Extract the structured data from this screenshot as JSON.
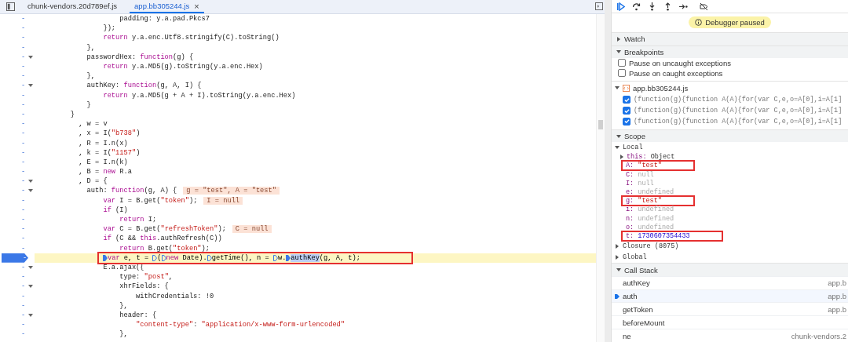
{
  "tabs": [
    {
      "label": "chunk-vendors.20d789ef.js",
      "selected": false
    },
    {
      "label": "app.bb305244.js",
      "selected": true,
      "close": "×"
    }
  ],
  "code_lines": [
    {
      "kind": "code",
      "number": "-",
      "fold": false,
      "text": "                    padding: y.a.pad.Pkcs7"
    },
    {
      "kind": "code",
      "number": "-",
      "fold": false,
      "text": "                });"
    },
    {
      "kind": "code",
      "number": "-",
      "fold": false,
      "text": "                return y.a.enc.Utf8.stringify(C).toString()"
    },
    {
      "kind": "code",
      "number": "-",
      "fold": false,
      "text": "            },"
    },
    {
      "kind": "code",
      "number": "-",
      "fold": true,
      "text": "            passwordHex: function(g) {"
    },
    {
      "kind": "code",
      "number": "-",
      "fold": false,
      "text": "                return y.a.MD5(g).toString(y.a.enc.Hex)"
    },
    {
      "kind": "code",
      "number": "-",
      "fold": false,
      "text": "            },"
    },
    {
      "kind": "code",
      "number": "-",
      "fold": true,
      "text": "            authKey: function(g, A, I) {"
    },
    {
      "kind": "code",
      "number": "-",
      "fold": false,
      "text": "                return y.a.MD5(g + A + I).toString(y.a.enc.Hex)"
    },
    {
      "kind": "code",
      "number": "-",
      "fold": false,
      "text": "            }"
    },
    {
      "kind": "code",
      "number": "-",
      "fold": false,
      "text": "        }"
    },
    {
      "kind": "code",
      "number": "-",
      "fold": false,
      "text": "          , w = v"
    },
    {
      "kind": "code",
      "number": "-",
      "fold": false,
      "text": "          , x = I(\"b738\")"
    },
    {
      "kind": "code",
      "number": "-",
      "fold": false,
      "text": "          , R = I.n(x)"
    },
    {
      "kind": "code",
      "number": "-",
      "fold": false,
      "text": "          , k = I(\"1157\")"
    },
    {
      "kind": "code",
      "number": "-",
      "fold": false,
      "text": "          , E = I.n(k)"
    },
    {
      "kind": "code",
      "number": "-",
      "fold": false,
      "text": "          , B = new R.a"
    },
    {
      "kind": "code",
      "number": "-",
      "fold": true,
      "text": "          , D = {"
    },
    {
      "kind": "code",
      "number": "-",
      "fold": true,
      "text": "            auth: function(g, A) {",
      "inline_value": "g = \"test\", A = \"test\""
    },
    {
      "kind": "code",
      "number": "-",
      "fold": false,
      "text": "                var I = B.get(\"token\");",
      "inline_value": "I = null"
    },
    {
      "kind": "code",
      "number": "-",
      "fold": false,
      "text": "                if (I)"
    },
    {
      "kind": "code",
      "number": "-",
      "fold": false,
      "text": "                    return I;"
    },
    {
      "kind": "code",
      "number": "-",
      "fold": false,
      "text": "                var C = B.get(\"refreshToken\");",
      "inline_value": "C = null"
    },
    {
      "kind": "code",
      "number": "-",
      "fold": false,
      "text": "                if (C && this.authRefresh(C))"
    },
    {
      "kind": "code",
      "number": "-",
      "fold": false,
      "text": "                    return B.get(\"token\");"
    },
    {
      "kind": "paused",
      "number": "-",
      "fold": false,
      "annotated": true,
      "segments": [
        {
          "kind": "active",
          "text": "var e, t = ",
          "highlighted": false
        },
        {
          "kind": "inactive",
          "text": "(",
          "highlighted": false
        },
        {
          "kind": "inactive",
          "text": "new Date).",
          "highlighted": false
        },
        {
          "kind": "inactive",
          "text": "getTime(), n = ",
          "highlighted": false
        },
        {
          "kind": "inactive",
          "text": "w.",
          "highlighted": false
        },
        {
          "kind": "active",
          "text": "authKey",
          "highlighted": true
        },
        {
          "kind": "plain",
          "text": "(g, A, t);",
          "highlighted": false
        }
      ]
    },
    {
      "kind": "code",
      "number": "-",
      "fold": true,
      "text": "                E.a.ajax({"
    },
    {
      "kind": "code",
      "number": "-",
      "fold": false,
      "text": "                    type: \"post\","
    },
    {
      "kind": "code",
      "number": "-",
      "fold": true,
      "text": "                    xhrFields: {"
    },
    {
      "kind": "code",
      "number": "-",
      "fold": false,
      "text": "                        withCredentials: !0"
    },
    {
      "kind": "code",
      "number": "-",
      "fold": false,
      "text": "                    },"
    },
    {
      "kind": "code",
      "number": "-",
      "fold": true,
      "text": "                    header: {"
    },
    {
      "kind": "code",
      "number": "-",
      "fold": false,
      "text": "                        \"content-type\": \"application/x-www-form-urlencoded\""
    },
    {
      "kind": "code",
      "number": "-",
      "fold": false,
      "text": "                    },"
    }
  ],
  "debugger": {
    "status": "Debugger paused",
    "watch": {
      "label": "Watch",
      "expanded": false
    },
    "breakpoints": {
      "label": "Breakpoints",
      "expanded": true,
      "options": [
        {
          "label": "Pause on uncaught exceptions",
          "checked": false
        },
        {
          "label": "Pause on caught exceptions",
          "checked": false
        }
      ],
      "file": {
        "name": "app.bb305244.js",
        "expanded": true,
        "items": [
          {
            "code": "(function(g){function A(A){for(var C,e,o=A[0],i=A[1]",
            "checked": true
          },
          {
            "code": "(function(g){function A(A){for(var C,e,o=A[0],i=A[1]",
            "checked": true
          },
          {
            "code": "(function(g){function A(A){for(var C,e,o=A[0],i=A[1]",
            "checked": true
          }
        ]
      }
    },
    "scope": {
      "label": "Scope",
      "expanded": true,
      "local": {
        "label": "Local",
        "expanded": true,
        "entries": [
          {
            "name": "this:",
            "value": "Object",
            "kind": "object",
            "annotated": false
          },
          {
            "name": "A:",
            "value": "\"test\"",
            "kind": "string",
            "annotated": true
          },
          {
            "name": "C:",
            "value": "null",
            "kind": "empty",
            "annotated": false
          },
          {
            "name": "I:",
            "value": "null",
            "kind": "empty",
            "annotated": false
          },
          {
            "name": "e:",
            "value": "undefined",
            "kind": "empty",
            "annotated": false
          },
          {
            "name": "g:",
            "value": "\"test\"",
            "kind": "string",
            "annotated": true
          },
          {
            "name": "i:",
            "value": "undefined",
            "kind": "empty",
            "annotated": false
          },
          {
            "name": "n:",
            "value": "undefined",
            "kind": "empty",
            "annotated": false
          },
          {
            "name": "o:",
            "value": "undefined",
            "kind": "empty",
            "annotated": false
          },
          {
            "name": "t:",
            "value": "1730607354433",
            "kind": "number",
            "annotated": true
          }
        ]
      },
      "groups": [
        {
          "label": "Closure (8075)",
          "expanded": false
        },
        {
          "label": "Global",
          "expanded": false
        }
      ]
    },
    "call_stack": {
      "label": "Call Stack",
      "expanded": true,
      "frames": [
        {
          "name": "authKey",
          "location": "app.b",
          "selected": false
        },
        {
          "name": "auth",
          "location": "app.b",
          "selected": true
        },
        {
          "name": "getToken",
          "location": "app.b",
          "selected": false
        },
        {
          "name": "beforeMount",
          "selected": false
        },
        {
          "name": "ne",
          "location": "chunk-vendors.2",
          "selected": false
        }
      ]
    }
  }
}
